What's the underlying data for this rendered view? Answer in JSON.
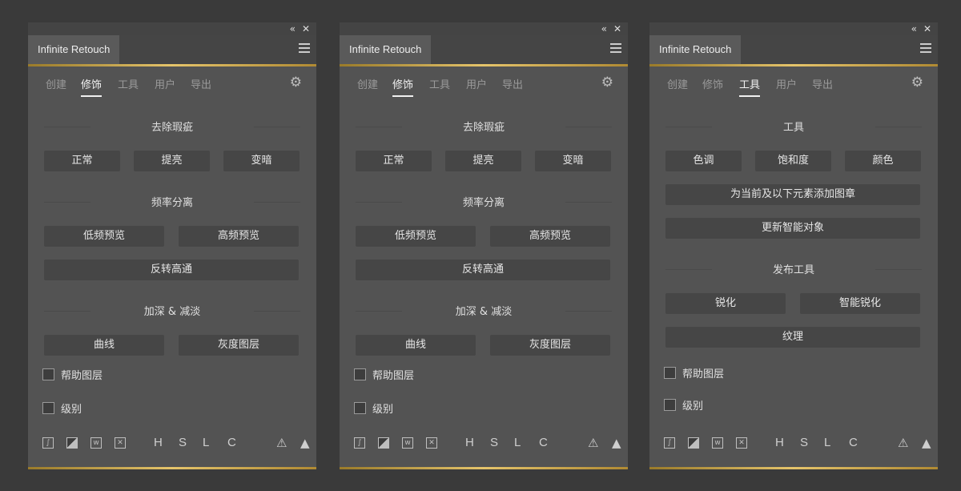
{
  "panels": [
    {
      "title": "Infinite Retouch",
      "collapse_label": "«",
      "close_label": "✕",
      "nav": [
        "创建",
        "修饰",
        "工具",
        "用户",
        "导出"
      ],
      "active_nav": "修饰",
      "sections": {
        "s1": "去除瑕疵",
        "s2": "频率分离",
        "s3": "加深 & 减淡"
      },
      "buttons": {
        "normal": "正常",
        "brighten": "提亮",
        "darken": "变暗",
        "low_preview": "低频预览",
        "high_preview": "高频预览",
        "invert": "反转高通",
        "curve": "曲线",
        "gray_layer": "灰度图层"
      },
      "checks": {
        "help_layer": "帮助图层",
        "level": "级别"
      },
      "footer_letters": [
        "H",
        "S",
        "L",
        "C"
      ]
    },
    {
      "title": "Infinite Retouch",
      "collapse_label": "«",
      "close_label": "✕",
      "nav": [
        "创建",
        "修饰",
        "工具",
        "用户",
        "导出"
      ],
      "active_nav": "修饰",
      "sections": {
        "s1": "去除瑕疵",
        "s2": "频率分离",
        "s3": "加深 & 减淡"
      },
      "buttons": {
        "normal": "正常",
        "brighten": "提亮",
        "darken": "变暗",
        "low_preview": "低频预览",
        "high_preview": "高频预览",
        "invert": "反转高通",
        "curve": "曲线",
        "gray_layer": "灰度图层"
      },
      "checks": {
        "help_layer": "帮助图层",
        "level": "级别"
      },
      "footer_letters": [
        "H",
        "S",
        "L",
        "C"
      ]
    },
    {
      "title": "Infinite Retouch",
      "collapse_label": "«",
      "close_label": "✕",
      "nav": [
        "创建",
        "修饰",
        "工具",
        "用户",
        "导出"
      ],
      "active_nav": "工具",
      "sections": {
        "s1": "工具",
        "s2": "发布工具"
      },
      "buttons": {
        "tone": "色调",
        "saturation": "饱和度",
        "color": "颜色",
        "add_stamp": "为当前及以下元素添加图章",
        "update_smart": "更新智能对象",
        "sharpen": "锐化",
        "smart_sharpen": "智能锐化",
        "texture": "纹理"
      },
      "checks": {
        "help_layer": "帮助图层",
        "level": "级别"
      },
      "footer_letters": [
        "H",
        "S",
        "L",
        "C"
      ]
    }
  ],
  "icons": {
    "menu": "hamburger-menu-icon",
    "settings": "gear-icon",
    "warning_outline": "warning-outline-icon",
    "warning_filled": "warning-filled-icon"
  },
  "colors": {
    "accent_gold": "#e5c46b",
    "panel_bg": "#535353"
  }
}
